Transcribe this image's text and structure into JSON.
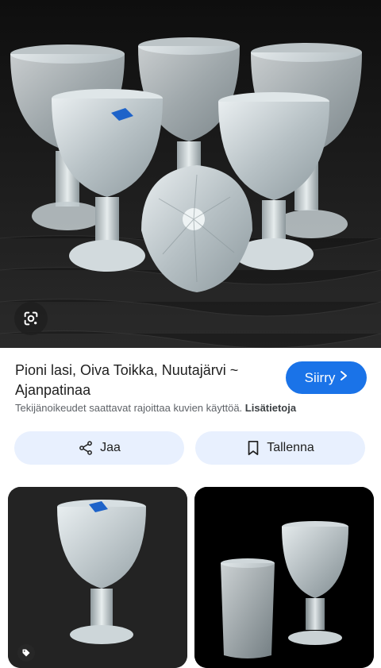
{
  "result": {
    "title": "Pioni lasi, Oiva Toikka, Nuutajärvi ~ Ajanpatinaa",
    "visit_label": "Siirry",
    "copyright_text": "Tekijänoikeudet saattavat rajoittaa kuvien käyttöä.",
    "more_info_label": "Lisätietoja"
  },
  "actions": {
    "share_label": "Jaa",
    "save_label": "Tallenna"
  },
  "icons": {
    "lens": "google-lens-icon",
    "visit_chevron": "chevron-right-icon",
    "share": "share-icon",
    "save": "bookmark-icon",
    "tag": "tag-icon"
  },
  "colors": {
    "accent": "#1a73e8",
    "pill_bg": "#e8f0fe",
    "muted_text": "#5f6368"
  }
}
